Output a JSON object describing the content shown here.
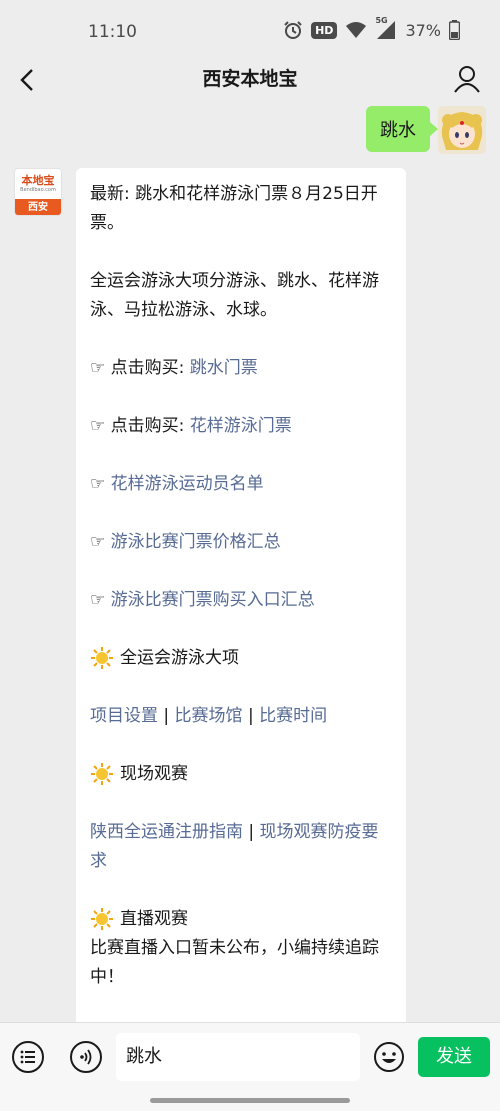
{
  "status_bar": {
    "time": "11:10",
    "hd_label": "HD",
    "network_label": "5G",
    "battery": "37%"
  },
  "nav": {
    "title": "西安本地宝"
  },
  "user_message": {
    "text": "跳水"
  },
  "bot": {
    "avatar_logo": "本地宝",
    "avatar_logo_sub": "Bendibao.com",
    "avatar_city": "西安"
  },
  "reply": {
    "intro": "最新: 跳水和花样游泳门票８月25日开票。",
    "events": "全运会游泳大项分游泳、跳水、花样游泳、马拉松游泳、水球。",
    "buy1_prefix": "☞ 点击购买: ",
    "buy1_link": "跳水门票",
    "buy2_prefix": "☞ 点击购买: ",
    "buy2_link": "花样游泳门票",
    "hand": "☞ ",
    "athletes_link": "花样游泳运动员名单",
    "prices_link": "游泳比赛门票价格汇总",
    "entrances_link": "游泳比赛门票购买入口汇总",
    "section1_title": "全运会游泳大项",
    "section1_links": [
      "项目设置",
      "比赛场馆",
      "比赛时间"
    ],
    "separator": " | ",
    "section2_title": "现场观赛",
    "section2_link1": "陕西全运通注册指南",
    "section2_link2": "现场观赛防疫要求",
    "section3_title": "直播观赛",
    "section3_text": "比赛直播入口暂未公布，小编持续追踪中！"
  },
  "input_bar": {
    "input_value": "跳水",
    "send_label": "发送"
  },
  "colors": {
    "link": "#576b95",
    "my_bubble": "#95ec69",
    "send_button": "#07c160"
  }
}
